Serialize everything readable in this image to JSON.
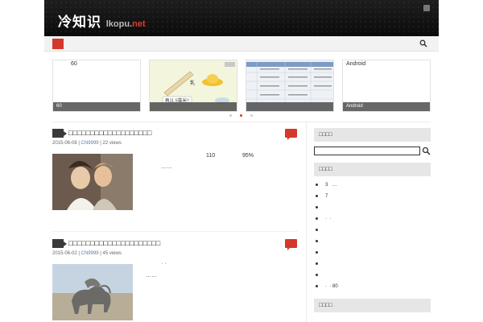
{
  "site": {
    "logo_text": "冷知识",
    "logo_domain": "lkopu.",
    "logo_tld": "net"
  },
  "slider": {
    "slides": [
      {
        "top_text": "60",
        "caption": "60"
      },
      {
        "top_text": "",
        "caption": ""
      },
      {
        "top_text": "",
        "caption": ""
      },
      {
        "top_text": "Android",
        "caption": "Android"
      }
    ],
    "slide2_label": "再11.5毫米!!",
    "slide2_small": "乳"
  },
  "posts": [
    {
      "title": "□□□□□□□□□□□□□□□□□□□",
      "date": "2015-06-08",
      "author": "CN9999",
      "views": "22 views",
      "excerpt_line1_a": "110",
      "excerpt_line1_b": "95%",
      "excerpt_line2": "……"
    },
    {
      "title": "□□□□□□□□□□□□□□□□□□□□□",
      "date": "2015-06-02",
      "author": "CN9999",
      "views": "45 views",
      "excerpt_line1": "·   ·",
      "excerpt_line2": "……"
    }
  ],
  "sidebar": {
    "widget1_title": "□□□□",
    "widget2_title": "□□□□",
    "widget3_title": "□□□□",
    "items": [
      "3   …",
      "7",
      "",
      "·  ·",
      "",
      "",
      "",
      "",
      "",
      "·  · 80"
    ]
  }
}
